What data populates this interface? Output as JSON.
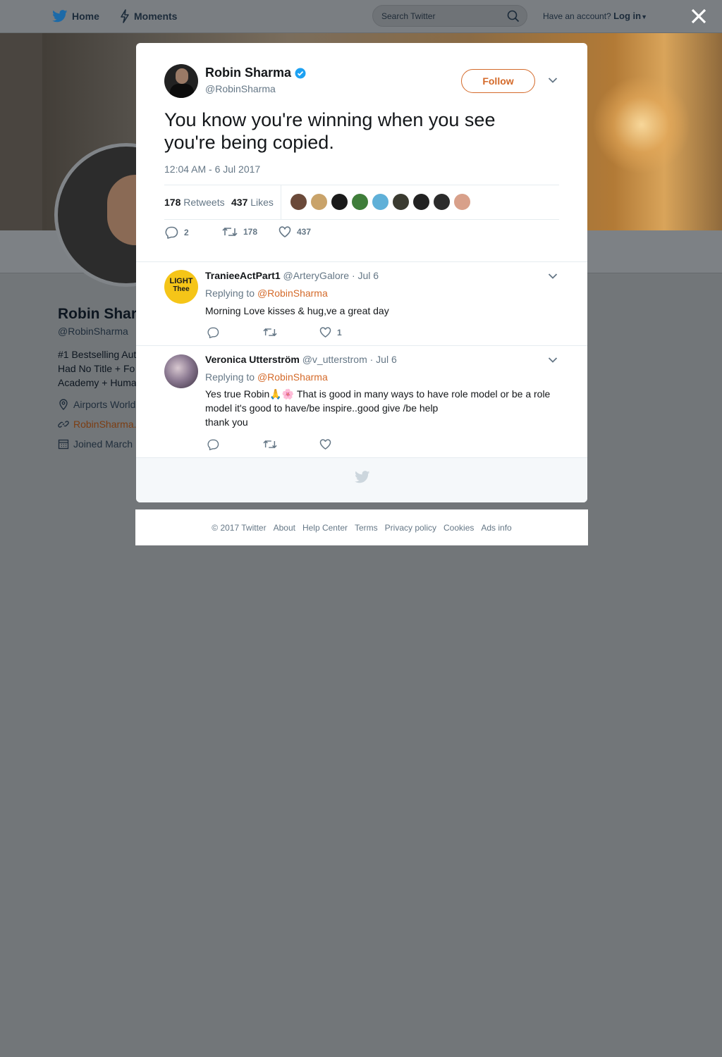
{
  "nav": {
    "home": "Home",
    "moments": "Moments",
    "search_placeholder": "Search Twitter",
    "have_account": "Have an account?",
    "login": "Log in"
  },
  "profile_bg": {
    "name": "Robin Shar",
    "handle": "@RobinSharma",
    "bio_lines": [
      "#1 Bestselling Aut",
      "Had No Title + Fo",
      "Academy + Huma"
    ],
    "location": "Airports World",
    "website": "RobinSharma.",
    "joined": "Joined March"
  },
  "tweet": {
    "author_name": "Robin Sharma",
    "author_handle": "@RobinSharma",
    "follow_label": "Follow",
    "text": "You know you're winning when you see you're being copied.",
    "timestamp": "12:04 AM - 6 Jul 2017",
    "retweets_count": "178",
    "retweets_label": "Retweets",
    "likes_count": "437",
    "likes_label": "Likes",
    "reply_count": "2",
    "retweet_action_count": "178",
    "like_action_count": "437",
    "liker_colors": [
      "#6b4a3a",
      "#c9a36a",
      "#1a1a1a",
      "#3f7d3a",
      "#5fb0d8",
      "#3a3a30",
      "#222222",
      "#2b2b2b",
      "#d8a08a"
    ]
  },
  "replies": [
    {
      "name": "TranieeActPart1",
      "handle": "@ArteryGalore",
      "date": "· Jul 6",
      "replying_label": "Replying to",
      "replying_to": "@RobinSharma",
      "text": "Morning Love kisses & hug,ve a great day",
      "like_count": "1",
      "avatar_text_1": "LIGHT",
      "avatar_text_2": "Thee",
      "avatar_color": "#f5c518"
    },
    {
      "name": "Veronica Utterström",
      "handle": "@v_utterstrom",
      "date": "· Jul 6",
      "replying_label": "Replying to",
      "replying_to": "@RobinSharma",
      "text_line_1": "Yes true Robin🙏🌸 That is good in many ways to have role model or be a role model it's good to have/be inspire..good give /be help",
      "text_line_2": "thank you",
      "like_count": "",
      "avatar_color": "#6a5a78"
    }
  ],
  "footer": {
    "copyright": "© 2017 Twitter",
    "about": "About",
    "help": "Help Center",
    "terms": "Terms",
    "privacy": "Privacy policy",
    "cookies": "Cookies",
    "ads": "Ads info"
  },
  "colors": {
    "accent": "#d46a2a",
    "twitter_blue": "#1da1f2",
    "overlay": "#727679"
  }
}
